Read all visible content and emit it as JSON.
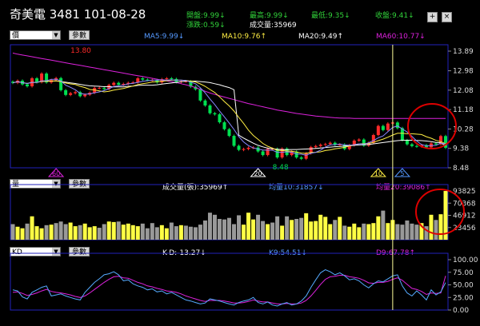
{
  "header": {
    "title": "奇美電 3481 101-08-28",
    "open": "開盤:9.99↓",
    "high": "最高:9.99↓",
    "low": "最低:9.35↓",
    "close": "收盤:9.41↓",
    "change": "漲跌:0.59↓",
    "volume": "成交量:35969",
    "btn_plus": "+",
    "btn_close": "×"
  },
  "price_panel": {
    "period_select": "價",
    "param_button": "參數",
    "ma5": "MA5:9.99↓",
    "ma10": "MA10:9.76↑",
    "ma20": "MA20:9.49↑",
    "ma60": "MA60:10.77↓",
    "high_mark": "13.80",
    "low_mark": "8.48",
    "tri_labels": [
      "60",
      "20",
      "10",
      "5"
    ]
  },
  "volume_panel": {
    "select": "量",
    "param_button": "參數",
    "vol_label": "成交量(張):35969↑",
    "ma10_label": "均量10:31857↓",
    "ma20_label": "均量20:39086↑"
  },
  "kd_panel": {
    "select": "KD",
    "param_button": "參數",
    "kd_label": "K-D:-13.27↓",
    "k_label": "K9:54.51↓",
    "d_label": "D9:67.78↑"
  },
  "colors": {
    "up": "#ff2a2a",
    "down": "#00e050",
    "ma5": "#ffffff",
    "ma10": "#ffee44",
    "ma20": "#ffffff",
    "ma60": "#dd22dd",
    "volume_up": "#ffff44",
    "volume_down": "#999999",
    "axis_border": "#2222bb",
    "k_line": "#55aaff",
    "d_line": "#dd22dd",
    "cursor": "#ffff99",
    "highlight_circle": "#dd0000"
  },
  "chart_data": [
    {
      "type": "candlestick",
      "title": "",
      "y_ticks": [
        "13.89",
        "12.98",
        "12.08",
        "11.18",
        "10.28",
        "9.38",
        "8.48"
      ],
      "ylim": [
        8.48,
        13.89
      ],
      "close": [
        12.42,
        12.52,
        12.35,
        12.26,
        12.63,
        12.45,
        12.85,
        12.44,
        12.55,
        12.64,
        12.08,
        11.86,
        11.94,
        11.99,
        11.8,
        11.87,
        11.96,
        12.18,
        12.18,
        12.13,
        12.32,
        12.42,
        12.33,
        12.37,
        12.42,
        12.44,
        12.63,
        12.57,
        12.55,
        12.55,
        12.44,
        12.59,
        12.63,
        12.6,
        12.45,
        12.49,
        12.49,
        12.24,
        12.12,
        11.6,
        11.37,
        11.01,
        10.96,
        10.59,
        10.27,
        9.96,
        9.5,
        9.31,
        9.35,
        9.41,
        9.42,
        9.24,
        9.07,
        9.36,
        9.36,
        8.96,
        9.37,
        9.07,
        9.23,
        8.96,
        8.9,
        9.15,
        9.44,
        9.49,
        9.55,
        9.58,
        9.64,
        9.55,
        9.56,
        9.35,
        9.53,
        9.74,
        9.79,
        9.51,
        9.64,
        10.0,
        10.42,
        10.23,
        10.53,
        10.58,
        10.32,
        9.76,
        9.57,
        9.49,
        9.47,
        9.53,
        9.43,
        9.61,
        9.57,
        9.95,
        9.41
      ],
      "ma5": [
        12.42,
        12.47,
        12.43,
        12.39,
        12.44,
        12.44,
        12.51,
        12.52,
        12.58,
        12.59,
        12.51,
        12.31,
        12.21,
        12.1,
        11.93,
        11.89,
        11.91,
        11.96,
        12.0,
        12.06,
        12.15,
        12.25,
        12.28,
        12.31,
        12.37,
        12.4,
        12.44,
        12.49,
        12.52,
        12.55,
        12.55,
        12.56,
        12.55,
        12.56,
        12.54,
        12.55,
        12.53,
        12.45,
        12.38,
        12.19,
        11.96,
        11.67,
        11.41,
        11.11,
        10.84,
        10.56,
        10.26,
        9.93,
        9.68,
        9.51,
        9.4,
        9.35,
        9.3,
        9.3,
        9.29,
        9.2,
        9.2,
        9.22,
        9.2,
        9.12,
        9.11,
        9.06,
        9.15,
        9.2,
        9.3,
        9.44,
        9.54,
        9.55,
        9.58,
        9.54,
        9.53,
        9.55,
        9.59,
        9.58,
        9.64,
        9.74,
        9.87,
        9.96,
        10.16,
        10.35,
        10.42,
        10.28,
        10.14,
        9.94,
        9.72,
        9.56,
        9.5,
        9.51,
        9.52,
        9.62,
        9.59
      ],
      "ma10": [
        12.42,
        12.47,
        12.43,
        12.39,
        12.44,
        12.44,
        12.49,
        12.49,
        12.5,
        12.51,
        12.48,
        12.41,
        12.37,
        12.34,
        12.26,
        12.2,
        12.11,
        12.09,
        12.05,
        12.0,
        12.03,
        12.08,
        12.12,
        12.16,
        12.22,
        12.27,
        12.34,
        12.38,
        12.41,
        12.46,
        12.47,
        12.49,
        12.52,
        12.54,
        12.54,
        12.54,
        12.53,
        12.5,
        12.46,
        12.37,
        12.26,
        12.11,
        11.97,
        11.77,
        11.55,
        11.35,
        11.11,
        10.82,
        10.54,
        10.23,
        9.98,
        9.8,
        9.61,
        9.48,
        9.39,
        9.29,
        9.28,
        9.26,
        9.25,
        9.21,
        9.16,
        9.15,
        9.19,
        9.2,
        9.22,
        9.28,
        9.31,
        9.36,
        9.39,
        9.43,
        9.49,
        9.55,
        9.59,
        9.6,
        9.61,
        9.66,
        9.74,
        9.81,
        9.9,
        10.0,
        10.08,
        10.08,
        10.06,
        10.06,
        10.04,
        10.02,
        9.92,
        9.85,
        9.75,
        9.69,
        9.6
      ],
      "ma20": [
        12.42,
        12.47,
        12.43,
        12.39,
        12.44,
        12.44,
        12.49,
        12.49,
        12.5,
        12.51,
        12.48,
        12.45,
        12.42,
        12.39,
        12.35,
        12.31,
        12.28,
        12.27,
        12.26,
        12.24,
        12.24,
        12.23,
        12.23,
        12.23,
        12.26,
        12.27,
        12.3,
        12.31,
        12.31,
        12.31,
        12.33,
        12.36,
        12.39,
        12.41,
        12.44,
        12.47,
        12.5,
        12.5,
        12.5,
        12.48,
        12.46,
        12.43,
        12.38,
        12.33,
        12.26,
        12.2,
        12.1,
        9.99,
        9.86,
        9.74,
        9.62,
        9.52,
        9.45,
        9.39,
        9.36,
        9.34,
        9.32,
        9.32,
        9.33,
        9.33,
        9.34,
        9.35,
        9.36,
        9.38,
        9.4,
        9.42,
        9.44,
        9.46,
        9.47,
        9.49,
        9.5,
        9.52,
        9.54,
        9.55,
        9.56,
        9.59,
        9.62,
        9.65,
        9.68,
        9.71,
        9.74,
        9.76,
        9.76,
        9.76,
        9.75,
        9.74,
        9.72,
        9.69,
        9.66,
        9.64,
        9.49
      ],
      "ma60": [
        13.8,
        13.75,
        13.71,
        13.67,
        13.63,
        13.59,
        13.55,
        13.51,
        13.47,
        13.43,
        13.39,
        13.35,
        13.31,
        13.27,
        13.23,
        13.19,
        13.15,
        13.11,
        13.07,
        13.03,
        12.99,
        12.95,
        12.91,
        12.87,
        12.83,
        12.79,
        12.75,
        12.71,
        12.67,
        12.63,
        12.59,
        12.55,
        12.51,
        12.47,
        12.43,
        12.38,
        12.33,
        12.27,
        12.2,
        12.12,
        12.03,
        11.95,
        11.88,
        11.82,
        11.76,
        11.7,
        11.64,
        11.58,
        11.52,
        11.46,
        11.41,
        11.36,
        11.31,
        11.26,
        11.21,
        11.16,
        11.12,
        11.08,
        11.04,
        11.0,
        10.97,
        10.94,
        10.91,
        10.88,
        10.86,
        10.84,
        10.82,
        10.8,
        10.79,
        10.78,
        10.78,
        10.77,
        10.77,
        10.77,
        10.77,
        10.77,
        10.77,
        10.77,
        10.77,
        10.77,
        10.77,
        10.77,
        10.77,
        10.77,
        10.77,
        10.77,
        10.77,
        10.77,
        10.77,
        10.77,
        10.77
      ]
    },
    {
      "type": "bar",
      "title": "",
      "y_ticks": [
        "93825",
        "70368",
        "46912",
        "23456"
      ],
      "ylim": [
        0,
        93825
      ],
      "values": [
        30000,
        25000,
        22000,
        31000,
        45000,
        26000,
        22000,
        28000,
        29000,
        32000,
        35000,
        30000,
        33000,
        26000,
        28000,
        31000,
        24000,
        26000,
        23000,
        30000,
        35000,
        34000,
        35000,
        29000,
        31000,
        28000,
        26000,
        31000,
        22000,
        32000,
        24000,
        28000,
        22000,
        33000,
        26000,
        28000,
        27000,
        25000,
        24000,
        29000,
        37000,
        52000,
        48000,
        40000,
        39000,
        42000,
        30000,
        47000,
        29000,
        52000,
        39000,
        48000,
        36000,
        30000,
        33000,
        45000,
        27000,
        45000,
        38000,
        40000,
        42000,
        51000,
        35000,
        36000,
        48000,
        44000,
        30000,
        38000,
        44000,
        27000,
        25000,
        31000,
        24000,
        31000,
        30000,
        32000,
        45000,
        56000,
        32000,
        38000,
        30000,
        29000,
        37000,
        31000,
        29000,
        32000,
        26000,
        48000,
        38000,
        49000,
        93825
      ],
      "up": [
        0,
        1,
        1,
        0,
        1,
        1,
        1,
        0,
        1,
        0,
        0,
        0,
        1,
        1,
        0,
        1,
        1,
        1,
        0,
        0,
        1,
        1,
        0,
        1,
        1,
        1,
        1,
        0,
        0,
        0,
        0,
        1,
        1,
        0,
        0,
        1,
        0,
        0,
        0,
        0,
        0,
        0,
        0,
        0,
        0,
        0,
        0,
        0,
        1,
        1,
        1,
        0,
        0,
        1,
        0,
        0,
        1,
        0,
        1,
        0,
        0,
        1,
        1,
        1,
        1,
        1,
        1,
        0,
        1,
        0,
        1,
        1,
        1,
        0,
        1,
        1,
        1,
        0,
        1,
        1,
        0,
        0,
        0,
        0,
        0,
        1,
        0,
        1,
        0,
        1,
        1
      ]
    },
    {
      "type": "line",
      "title": "",
      "y_ticks": [
        "100.00",
        "75.00",
        "50.00",
        "25.00",
        "0.00"
      ],
      "ylim": [
        0,
        100
      ],
      "series": [
        {
          "name": "K9",
          "values": [
            40,
            38,
            26,
            22,
            35,
            40,
            45,
            48,
            28,
            30,
            32,
            28,
            25,
            22,
            20,
            35,
            45,
            55,
            62,
            70,
            72,
            76,
            70,
            58,
            60,
            52,
            48,
            45,
            40,
            42,
            36,
            38,
            32,
            35,
            30,
            25,
            20,
            18,
            15,
            12,
            14,
            22,
            20,
            18,
            15,
            12,
            10,
            15,
            18,
            20,
            25,
            15,
            12,
            16,
            10,
            8,
            12,
            15,
            10,
            12,
            18,
            28,
            45,
            60,
            74,
            80,
            76,
            70,
            74,
            68,
            60,
            62,
            58,
            50,
            44,
            52,
            58,
            56,
            62,
            68,
            70,
            48,
            34,
            28,
            38,
            30,
            20,
            40,
            30,
            36,
            54.51
          ]
        },
        {
          "name": "D9",
          "values": [
            35,
            36,
            33,
            29,
            31,
            34,
            38,
            41,
            37,
            35,
            34,
            32,
            30,
            27,
            25,
            28,
            34,
            41,
            48,
            55,
            61,
            66,
            67,
            64,
            63,
            59,
            55,
            52,
            48,
            46,
            43,
            41,
            38,
            37,
            35,
            32,
            28,
            25,
            22,
            19,
            17,
            19,
            19,
            19,
            18,
            16,
            14,
            14,
            15,
            17,
            20,
            18,
            16,
            16,
            14,
            12,
            12,
            13,
            12,
            12,
            14,
            19,
            28,
            39,
            51,
            61,
            66,
            67,
            69,
            69,
            66,
            65,
            63,
            59,
            54,
            53,
            55,
            55,
            57,
            61,
            64,
            59,
            51,
            43,
            41,
            37,
            31,
            34,
            33,
            34,
            67.78
          ]
        }
      ]
    }
  ]
}
